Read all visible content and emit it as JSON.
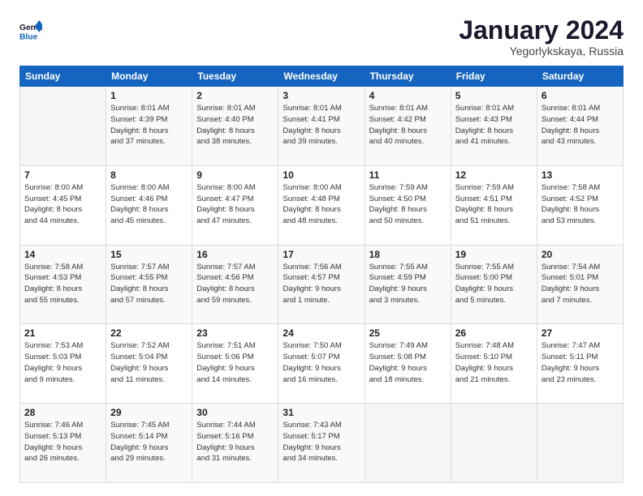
{
  "logo": {
    "general": "General",
    "blue": "Blue"
  },
  "header": {
    "month_year": "January 2024",
    "location": "Yegorlykskaya, Russia"
  },
  "weekdays": [
    "Sunday",
    "Monday",
    "Tuesday",
    "Wednesday",
    "Thursday",
    "Friday",
    "Saturday"
  ],
  "weeks": [
    [
      {
        "day": "",
        "info": ""
      },
      {
        "day": "1",
        "info": "Sunrise: 8:01 AM\nSunset: 4:39 PM\nDaylight: 8 hours\nand 37 minutes."
      },
      {
        "day": "2",
        "info": "Sunrise: 8:01 AM\nSunset: 4:40 PM\nDaylight: 8 hours\nand 38 minutes."
      },
      {
        "day": "3",
        "info": "Sunrise: 8:01 AM\nSunset: 4:41 PM\nDaylight: 8 hours\nand 39 minutes."
      },
      {
        "day": "4",
        "info": "Sunrise: 8:01 AM\nSunset: 4:42 PM\nDaylight: 8 hours\nand 40 minutes."
      },
      {
        "day": "5",
        "info": "Sunrise: 8:01 AM\nSunset: 4:43 PM\nDaylight: 8 hours\nand 41 minutes."
      },
      {
        "day": "6",
        "info": "Sunrise: 8:01 AM\nSunset: 4:44 PM\nDaylight: 8 hours\nand 43 minutes."
      }
    ],
    [
      {
        "day": "7",
        "info": "Sunrise: 8:00 AM\nSunset: 4:45 PM\nDaylight: 8 hours\nand 44 minutes."
      },
      {
        "day": "8",
        "info": "Sunrise: 8:00 AM\nSunset: 4:46 PM\nDaylight: 8 hours\nand 45 minutes."
      },
      {
        "day": "9",
        "info": "Sunrise: 8:00 AM\nSunset: 4:47 PM\nDaylight: 8 hours\nand 47 minutes."
      },
      {
        "day": "10",
        "info": "Sunrise: 8:00 AM\nSunset: 4:48 PM\nDaylight: 8 hours\nand 48 minutes."
      },
      {
        "day": "11",
        "info": "Sunrise: 7:59 AM\nSunset: 4:50 PM\nDaylight: 8 hours\nand 50 minutes."
      },
      {
        "day": "12",
        "info": "Sunrise: 7:59 AM\nSunset: 4:51 PM\nDaylight: 8 hours\nand 51 minutes."
      },
      {
        "day": "13",
        "info": "Sunrise: 7:58 AM\nSunset: 4:52 PM\nDaylight: 8 hours\nand 53 minutes."
      }
    ],
    [
      {
        "day": "14",
        "info": "Sunrise: 7:58 AM\nSunset: 4:53 PM\nDaylight: 8 hours\nand 55 minutes."
      },
      {
        "day": "15",
        "info": "Sunrise: 7:57 AM\nSunset: 4:55 PM\nDaylight: 8 hours\nand 57 minutes."
      },
      {
        "day": "16",
        "info": "Sunrise: 7:57 AM\nSunset: 4:56 PM\nDaylight: 8 hours\nand 59 minutes."
      },
      {
        "day": "17",
        "info": "Sunrise: 7:56 AM\nSunset: 4:57 PM\nDaylight: 9 hours\nand 1 minute."
      },
      {
        "day": "18",
        "info": "Sunrise: 7:55 AM\nSunset: 4:59 PM\nDaylight: 9 hours\nand 3 minutes."
      },
      {
        "day": "19",
        "info": "Sunrise: 7:55 AM\nSunset: 5:00 PM\nDaylight: 9 hours\nand 5 minutes."
      },
      {
        "day": "20",
        "info": "Sunrise: 7:54 AM\nSunset: 5:01 PM\nDaylight: 9 hours\nand 7 minutes."
      }
    ],
    [
      {
        "day": "21",
        "info": "Sunrise: 7:53 AM\nSunset: 5:03 PM\nDaylight: 9 hours\nand 9 minutes."
      },
      {
        "day": "22",
        "info": "Sunrise: 7:52 AM\nSunset: 5:04 PM\nDaylight: 9 hours\nand 11 minutes."
      },
      {
        "day": "23",
        "info": "Sunrise: 7:51 AM\nSunset: 5:06 PM\nDaylight: 9 hours\nand 14 minutes."
      },
      {
        "day": "24",
        "info": "Sunrise: 7:50 AM\nSunset: 5:07 PM\nDaylight: 9 hours\nand 16 minutes."
      },
      {
        "day": "25",
        "info": "Sunrise: 7:49 AM\nSunset: 5:08 PM\nDaylight: 9 hours\nand 18 minutes."
      },
      {
        "day": "26",
        "info": "Sunrise: 7:48 AM\nSunset: 5:10 PM\nDaylight: 9 hours\nand 21 minutes."
      },
      {
        "day": "27",
        "info": "Sunrise: 7:47 AM\nSunset: 5:11 PM\nDaylight: 9 hours\nand 23 minutes."
      }
    ],
    [
      {
        "day": "28",
        "info": "Sunrise: 7:46 AM\nSunset: 5:13 PM\nDaylight: 9 hours\nand 26 minutes."
      },
      {
        "day": "29",
        "info": "Sunrise: 7:45 AM\nSunset: 5:14 PM\nDaylight: 9 hours\nand 29 minutes."
      },
      {
        "day": "30",
        "info": "Sunrise: 7:44 AM\nSunset: 5:16 PM\nDaylight: 9 hours\nand 31 minutes."
      },
      {
        "day": "31",
        "info": "Sunrise: 7:43 AM\nSunset: 5:17 PM\nDaylight: 9 hours\nand 34 minutes."
      },
      {
        "day": "",
        "info": ""
      },
      {
        "day": "",
        "info": ""
      },
      {
        "day": "",
        "info": ""
      }
    ]
  ]
}
